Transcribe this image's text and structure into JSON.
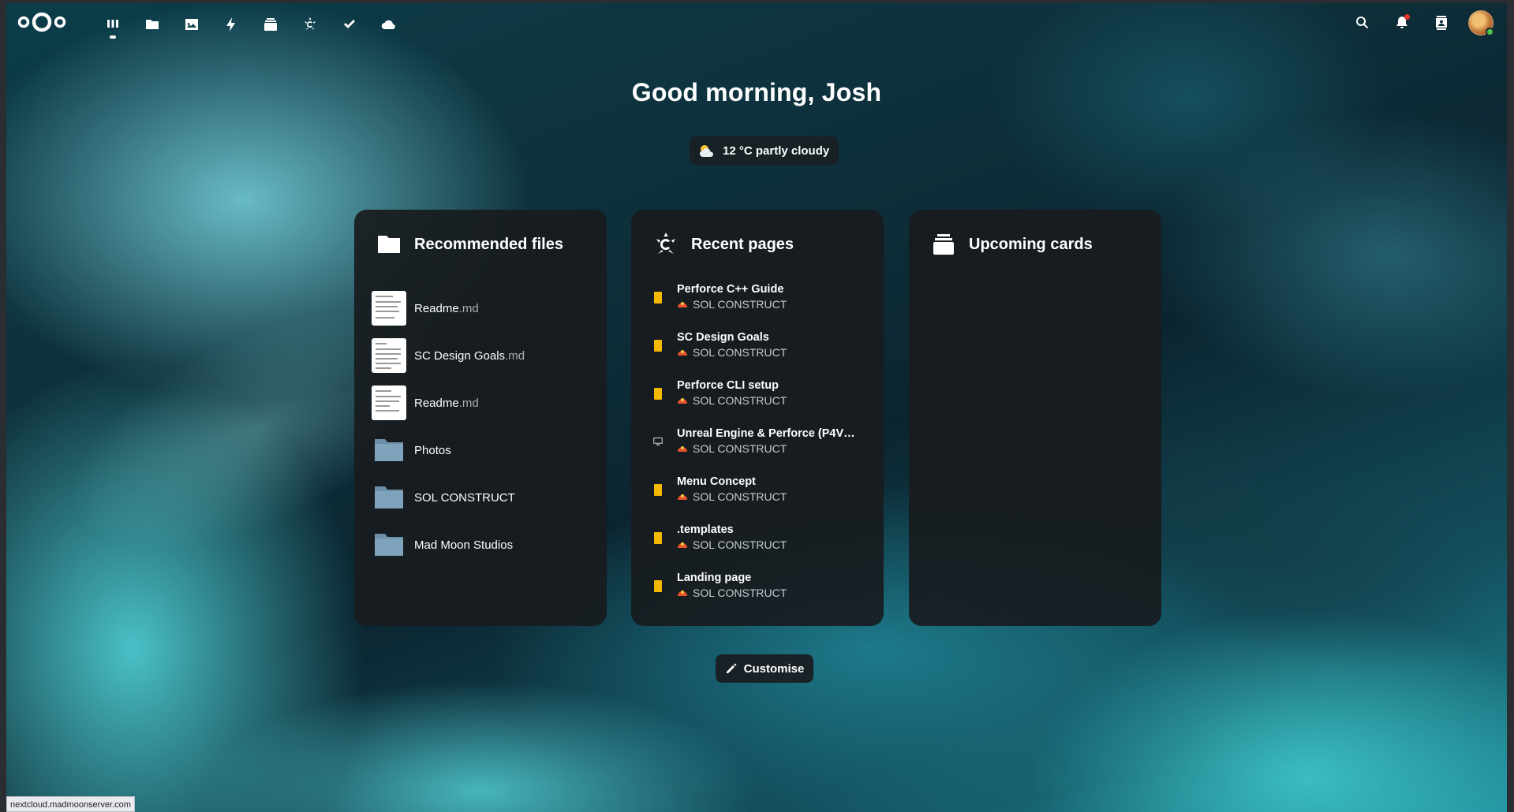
{
  "header": {
    "logo": "nextcloud-logo",
    "apps": [
      {
        "name": "dashboard",
        "icon": "dashboard-icon",
        "active": true
      },
      {
        "name": "files",
        "icon": "folder-icon"
      },
      {
        "name": "photos",
        "icon": "image-icon"
      },
      {
        "name": "activity",
        "icon": "lightning-icon"
      },
      {
        "name": "deck",
        "icon": "deck-icon"
      },
      {
        "name": "collectives",
        "icon": "collectives-icon"
      },
      {
        "name": "tasks",
        "icon": "checkmark-icon"
      },
      {
        "name": "external",
        "icon": "cloud-icon"
      }
    ],
    "right": [
      "search-icon",
      "bell-icon",
      "contacts-icon",
      "avatar"
    ]
  },
  "greeting": "Good morning, Josh",
  "weather": {
    "text": "12 °C partly cloudy",
    "icon": "partly-cloudy-icon"
  },
  "panels": {
    "recommended": {
      "title": "Recommended files",
      "items": [
        {
          "name": "Readme",
          "ext": ".md",
          "type": "file"
        },
        {
          "name": "SC Design Goals",
          "ext": ".md",
          "type": "file"
        },
        {
          "name": "Readme",
          "ext": ".md",
          "type": "file"
        },
        {
          "name": "Photos",
          "ext": "",
          "type": "folder"
        },
        {
          "name": "SOL CONSTRUCT",
          "ext": "",
          "type": "folder"
        },
        {
          "name": "Mad Moon Studios",
          "ext": "",
          "type": "folder"
        }
      ]
    },
    "recent_pages": {
      "title": "Recent pages",
      "items": [
        {
          "title": "Perforce C++ Guide",
          "collective": "SOL CONSTRUCT",
          "icon": "doc"
        },
        {
          "title": "SC Design Goals",
          "collective": "SOL CONSTRUCT",
          "icon": "doc"
        },
        {
          "title": "Perforce CLI setup",
          "collective": "SOL CONSTRUCT",
          "icon": "doc"
        },
        {
          "title": "Unreal Engine & Perforce (P4V) ...",
          "collective": "SOL CONSTRUCT",
          "icon": "screen"
        },
        {
          "title": "Menu Concept",
          "collective": "SOL CONSTRUCT",
          "icon": "doc"
        },
        {
          "title": ".templates",
          "collective": "SOL CONSTRUCT",
          "icon": "doc"
        },
        {
          "title": "Landing page",
          "collective": "SOL CONSTRUCT",
          "icon": "doc"
        }
      ]
    },
    "upcoming": {
      "title": "Upcoming cards"
    }
  },
  "customise_label": "Customise",
  "status_url": "nextcloud.madmoonserver.com",
  "colors": {
    "doc_icon": "#f5b800",
    "panel_bg": "#181b1e",
    "notification": "#e9322d",
    "online": "#4fc64f"
  }
}
